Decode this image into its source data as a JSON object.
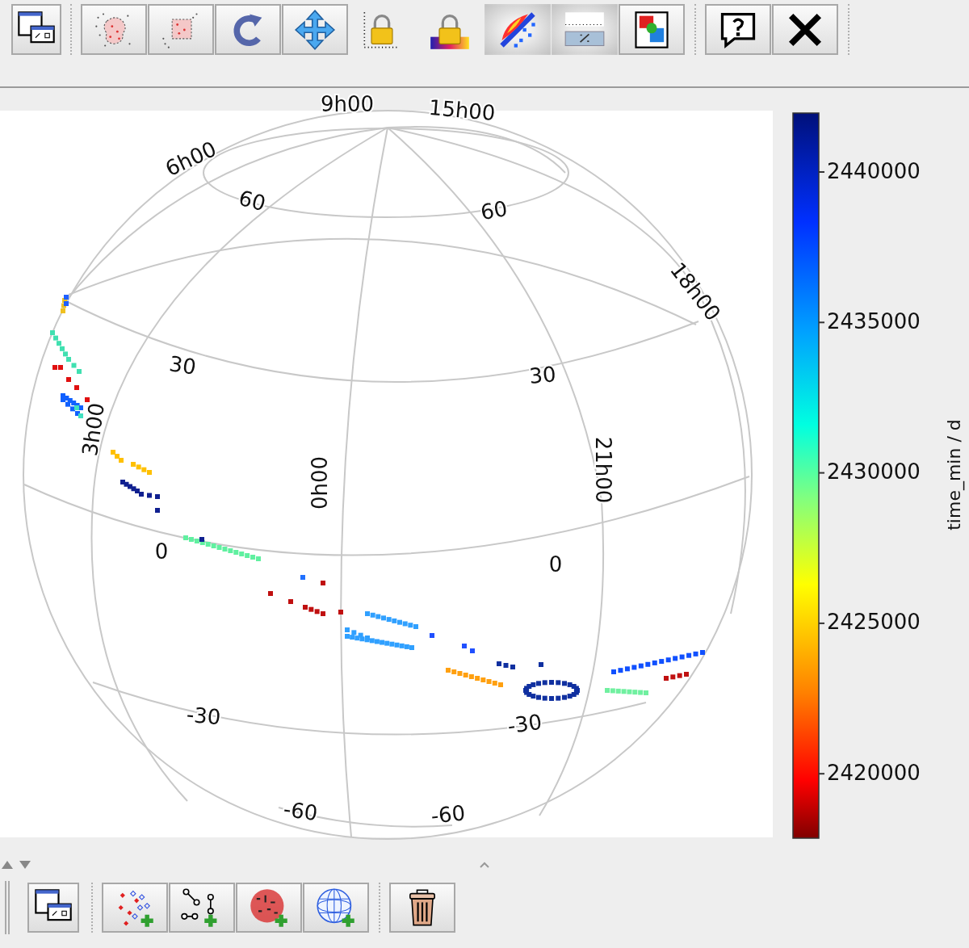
{
  "toolbar": {
    "groups": [
      {
        "items": [
          {
            "kind": "window",
            "selected": false
          }
        ]
      },
      {
        "items": [
          {
            "kind": "blob",
            "selected": false
          },
          {
            "kind": "rect",
            "selected": false
          },
          {
            "kind": "rotate",
            "selected": false
          },
          {
            "kind": "move",
            "selected": false
          },
          {
            "kind": "axislock",
            "selected": false
          },
          {
            "kind": "auxlock",
            "selected": false
          },
          {
            "kind": "density",
            "selected": true
          },
          {
            "kind": "sketch",
            "selected": true
          },
          {
            "kind": "export",
            "selected": false
          }
        ]
      },
      {
        "items": [
          {
            "kind": "help",
            "selected": false
          },
          {
            "kind": "close",
            "selected": false
          }
        ]
      }
    ]
  },
  "plot": {
    "grid_labels": [
      "9h00",
      "15h00",
      "6h00",
      "60",
      "60",
      "18h00",
      "30",
      "30",
      "3h00",
      "0h00",
      "21h00",
      "0",
      "0",
      "-30",
      "-30",
      "-60",
      "-60"
    ]
  },
  "colorbar": {
    "label": "time_min / d",
    "ticks": [
      "2440000",
      "2435000",
      "2430000",
      "2425000",
      "2420000"
    ]
  },
  "layers_toolbar": {
    "groups": [
      {
        "items": [
          {
            "kind": "window"
          }
        ]
      },
      {
        "items": [
          {
            "kind": "scatter"
          },
          {
            "kind": "pairs"
          },
          {
            "kind": "labels"
          },
          {
            "kind": "sky"
          }
        ]
      },
      {
        "items": [
          {
            "kind": "delete"
          }
        ]
      }
    ]
  }
}
